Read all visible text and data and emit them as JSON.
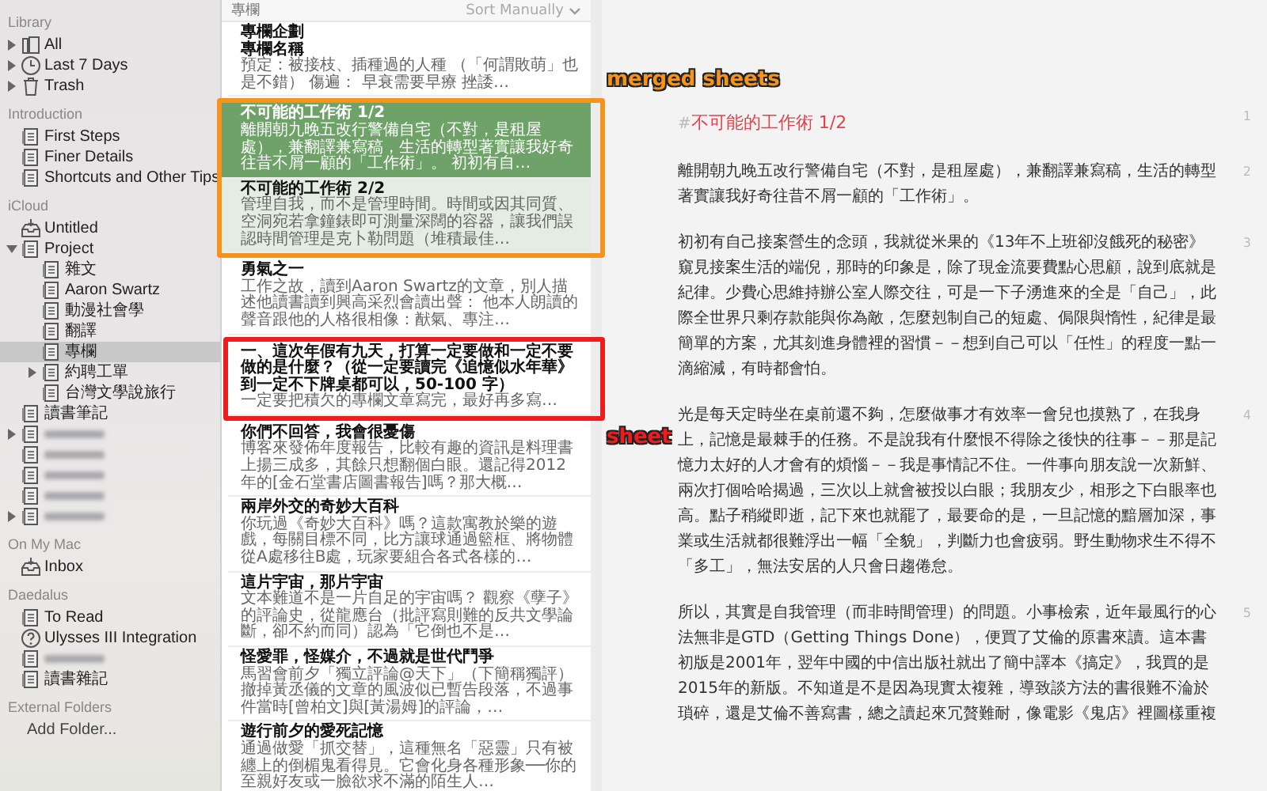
{
  "sidebar": {
    "sections": [
      {
        "title": "Library",
        "items": [
          {
            "label": "All",
            "kind": "library",
            "expandable": true,
            "expanded": false,
            "selected": false
          },
          {
            "label": "Last 7 Days",
            "kind": "clock",
            "expandable": true,
            "expanded": false,
            "selected": false
          },
          {
            "label": "Trash",
            "kind": "trash",
            "expandable": true,
            "expanded": false,
            "selected": false
          }
        ]
      },
      {
        "title": "Introduction",
        "items": [
          {
            "label": "First Steps",
            "kind": "group",
            "selected": false
          },
          {
            "label": "Finer Details",
            "kind": "group",
            "selected": false
          },
          {
            "label": "Shortcuts and Other Tips",
            "kind": "group",
            "selected": false
          }
        ]
      },
      {
        "title": "iCloud",
        "items": [
          {
            "label": "Untitled",
            "kind": "inbox",
            "selected": false
          },
          {
            "label": "Project",
            "kind": "group",
            "expandable": true,
            "expanded": true,
            "selected": false,
            "children": [
              {
                "label": "雜文",
                "kind": "group",
                "selected": false
              },
              {
                "label": "Aaron Swartz",
                "kind": "group",
                "selected": false
              },
              {
                "label": "動漫社會學",
                "kind": "group",
                "selected": false
              },
              {
                "label": "翻譯",
                "kind": "group",
                "selected": false
              },
              {
                "label": "專欄",
                "kind": "group",
                "selected": true
              },
              {
                "label": "約聘工單",
                "kind": "group",
                "expandable": true,
                "expanded": false,
                "selected": false
              },
              {
                "label": "台灣文學說旅行",
                "kind": "group",
                "selected": false
              }
            ]
          },
          {
            "label": "讀書筆記",
            "kind": "group",
            "selected": false
          },
          {
            "kind": "redacted",
            "expandable": true,
            "expanded": false,
            "selected": false
          },
          {
            "kind": "redacted",
            "selected": false
          },
          {
            "kind": "redacted",
            "selected": false
          },
          {
            "kind": "redacted",
            "selected": false
          },
          {
            "kind": "redacted",
            "expandable": true,
            "expanded": false,
            "selected": false
          }
        ]
      },
      {
        "title": "On My Mac",
        "items": [
          {
            "label": "Inbox",
            "kind": "inbox",
            "selected": false
          }
        ]
      },
      {
        "title": "Daedalus",
        "items": [
          {
            "label": "To Read",
            "kind": "group",
            "selected": false
          },
          {
            "label": "Ulysses III Integration",
            "kind": "help",
            "selected": false
          },
          {
            "kind": "redacted",
            "selected": false
          },
          {
            "label": "讀書雜記",
            "kind": "group",
            "selected": false
          }
        ]
      },
      {
        "title": "External Folders",
        "items": [
          {
            "label": "Add Folder...",
            "kind": "action",
            "selected": false
          }
        ]
      }
    ]
  },
  "sheet_list": {
    "title": "專欄",
    "sort": "Sort Manually",
    "sheets": [
      {
        "title": "專欄企劃",
        "subtitle": "專欄名稱",
        "preview": "預定：被接枝、插種過的人種 （「何謂敗萌」也是不錯） 傷遍： 早衰需要早療 挫諉…",
        "selected": false,
        "merged": false
      },
      {
        "title": "不可能的工作術 1/2",
        "preview": "離開朝九晚五改行警備自宅（不對，是租屋處），兼翻譯兼寫稿，生活的轉型著實讓我好奇往昔不屑一顧的「工作術」。 初初有自…",
        "selected": true,
        "merged": true,
        "annotation": {
          "label": "merged sheets",
          "color": "#f5941d"
        }
      },
      {
        "title": "不可能的工作術 2/2",
        "preview": "管理自我，而不是管理時間。時間或因其同質、空洞宛若拿鐘錶即可測量深闊的容器，讓我們誤認時間管理是克卜勒問題（堆積最佳…",
        "selected": false,
        "merged": true
      },
      {
        "title": "勇氣之一",
        "preview": "工作之故，讀到Aaron Swartz的文章，別人描述他讀書讀到興高采烈會讀出聲： 他本人朗讀的聲音跟他的人格很相像：猷氣、專注…",
        "selected": false,
        "merged": false
      },
      {
        "title": "一、這次年假有九天，打算一定要做和一定不要做的是什麼？（從一定要讀完《追憶似水年華》到一定不下牌桌都可以，50-100 字）",
        "preview": "一定要把積欠的專欄文章寫完，最好再多寫…",
        "selected": false,
        "merged": false,
        "annotation": {
          "label": "sheet",
          "color": "#ee1c1c"
        }
      },
      {
        "title": "你們不回答，我會很憂傷",
        "preview": "博客來發佈年度報告，比較有趣的資訊是料理書上揚三成多，其餘只想翻個白眼。還記得2012年的[金石堂書店圖書報告]嗎？那大概…",
        "selected": false,
        "merged": false
      },
      {
        "title": "兩岸外交的奇妙大百科",
        "preview": "你玩過《奇妙大百科》嗎？這款寓教於樂的遊戲，每關目標不同，比方讓球通過籃框、將物體從A處移往B處，玩家要組合各式各樣的…",
        "selected": false,
        "merged": false
      },
      {
        "title": "這片宇宙，那片宇宙",
        "preview": "文本難道不是一片自足的宇宙嗎？ 觀察《孽子》的評論史，從龍應台（批評寫則難的反共文學論斷，卻不約而同）認為「它倒也不是…",
        "selected": false,
        "merged": false
      },
      {
        "title": "怪愛罪，怪媒介，不過就是世代鬥爭",
        "preview": "馬習會前夕「獨立評論@天下」（下簡稱獨評）撤掉黃丞儀的文章的風波似已暫告段落，不過事件當時[曾柏文]與[黃湯姆]的評論，…",
        "selected": false,
        "merged": false
      },
      {
        "title": "遊行前夕的愛死記憶",
        "preview": "通過做愛「抓交替」，這種無名「惡靈」只有被纏上的倒楣鬼看得見。它會化身各種形象──你的至親好友或一臉欲求不滿的陌生人…",
        "selected": false,
        "merged": false
      }
    ]
  },
  "editor": {
    "heading": {
      "marker": "#",
      "text": "不可能的工作術 1/2",
      "number": "1"
    },
    "paragraphs": [
      {
        "text": "離開朝九晚五改行警備自宅（不對，是租屋處），兼翻譯兼寫稿，生活的轉型著實讓我好奇往昔不屑一顧的「工作術」。",
        "number": "2"
      },
      {
        "text": "初初有自己接案營生的念頭，我就從米果的《13年不上班卻沒餓死的秘密》窺見接案生活的端倪，那時的印象是，除了現金流要費點心思顧，說到底就是紀律。少費心思維持辦公室人際交往，可是一下子湧進來的全是「自己」，此際全世界只剩存款能與你為敵，怎麼剋制自己的短處、侷限與惰性，紀律是最簡單的方案，尤其刻進身體裡的習慣－－想到自己可以「任性」的程度一點一滴縮減，有時都會怕。",
        "number": "3"
      },
      {
        "text": "光是每天定時坐在桌前還不夠，怎麼做事才有效率一會兒也摸熟了，在我身上，記憶是最棘手的任務。不是說我有什麼恨不得除之後快的往事－－那是記憶力太好的人才會有的煩惱－－我是事情記不住。一件事向朋友說一次新鮮、兩次打個哈哈揭過，三次以上就會被投以白眼；我朋友少，相形之下白眼率也高。點子稍縱即逝，記下來也就罷了，最要命的是，一旦記憶的黯層加深，事業或生活就都很難浮出一幅「全貌」，判斷力也會疲弱。野生動物求生不得不「多工」，無法安居的人只會日趨倦怠。",
        "number": "4"
      },
      {
        "text": "所以，其實是自我管理（而非時間管理）的問題。小事檢索，近年最風行的心法無非是GTD（Getting Things Done），便買了艾倫的原書來讀。這本書初版是2001年，翌年中國的中信出版社就出了簡中譯本《搞定》，我買的是2015年的新版。不知道是不是因為現實太複雜，導致談方法的書很難不淪於瑣碎，還是艾倫不善寫書，總之讀起來冗贅難耐，像電影《鬼店》裡圖樣重複",
        "number": "5"
      }
    ]
  }
}
